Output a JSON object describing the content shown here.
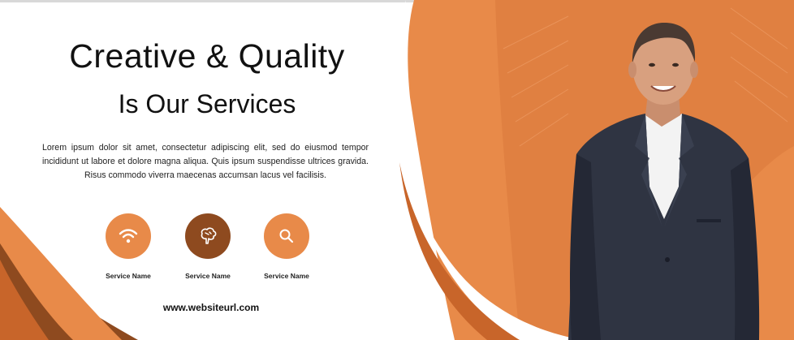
{
  "headline": {
    "line1": "Creative & Quality",
    "line2": "Is Our Services"
  },
  "description": "Lorem ipsum dolor sit amet, consectetur adipiscing elit, sed do eiusmod tempor incididunt ut labore et dolore magna aliqua. Quis ipsum suspendisse ultrices gravida. Risus commodo viverra maecenas accumsan lacus vel facilisis.",
  "services": [
    {
      "label": "Service Name",
      "icon": "wifi-icon",
      "color": "#e88a49"
    },
    {
      "label": "Service Name",
      "icon": "brain-icon",
      "color": "#8e4a1f"
    },
    {
      "label": "Service Name",
      "icon": "search-icon",
      "color": "#e88a49"
    }
  ],
  "website": "www.websiteurl.com",
  "colors": {
    "accent_orange": "#e88a49",
    "deep_orange": "#c8652a",
    "dark_brown": "#8e4a1f",
    "background": "#ffffff",
    "text": "#111111"
  },
  "photo": "businessman-in-dark-suit"
}
